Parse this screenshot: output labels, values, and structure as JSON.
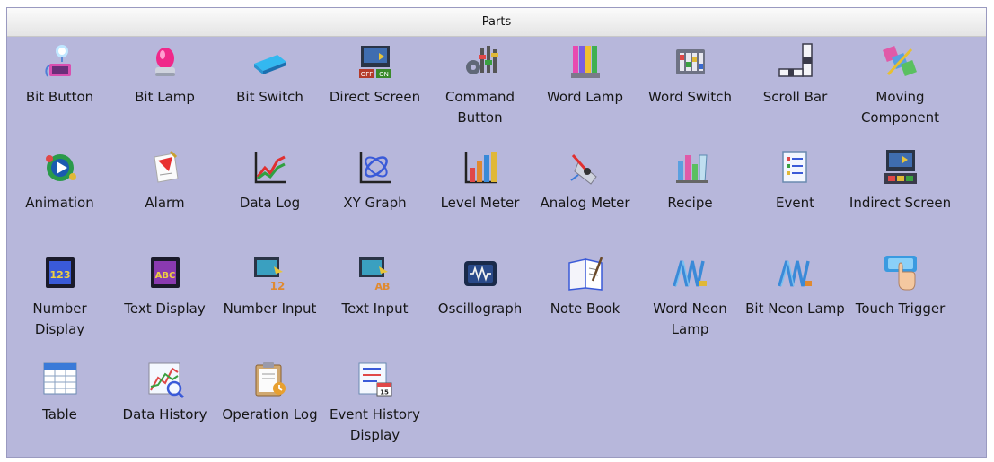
{
  "panel": {
    "title": "Parts"
  },
  "parts": [
    {
      "label": "Bit Button",
      "icon": "bit-button-icon"
    },
    {
      "label": "Bit Lamp",
      "icon": "bit-lamp-icon"
    },
    {
      "label": "Bit Switch",
      "icon": "bit-switch-icon"
    },
    {
      "label": "Direct Screen",
      "icon": "direct-screen-icon"
    },
    {
      "label": "Command Button",
      "icon": "command-button-icon"
    },
    {
      "label": "Word Lamp",
      "icon": "word-lamp-icon"
    },
    {
      "label": "Word Switch",
      "icon": "word-switch-icon"
    },
    {
      "label": "Scroll Bar",
      "icon": "scroll-bar-icon"
    },
    {
      "label": "Moving Component",
      "icon": "moving-component-icon"
    },
    {
      "label": "Animation",
      "icon": "animation-icon"
    },
    {
      "label": "Alarm",
      "icon": "alarm-icon"
    },
    {
      "label": "Data Log",
      "icon": "data-log-icon"
    },
    {
      "label": "XY Graph",
      "icon": "xy-graph-icon"
    },
    {
      "label": "Level Meter",
      "icon": "level-meter-icon"
    },
    {
      "label": "Analog Meter",
      "icon": "analog-meter-icon"
    },
    {
      "label": "Recipe",
      "icon": "recipe-icon"
    },
    {
      "label": "Event",
      "icon": "event-icon"
    },
    {
      "label": "Indirect Screen",
      "icon": "indirect-screen-icon"
    },
    {
      "label": "Number Display",
      "icon": "number-display-icon"
    },
    {
      "label": "Text Display",
      "icon": "text-display-icon"
    },
    {
      "label": "Number Input",
      "icon": "number-input-icon"
    },
    {
      "label": "Text Input",
      "icon": "text-input-icon"
    },
    {
      "label": "Oscillograph",
      "icon": "oscillograph-icon"
    },
    {
      "label": "Note Book",
      "icon": "note-book-icon"
    },
    {
      "label": "Word Neon Lamp",
      "icon": "word-neon-lamp-icon"
    },
    {
      "label": "Bit Neon Lamp",
      "icon": "bit-neon-lamp-icon"
    },
    {
      "label": "Touch Trigger",
      "icon": "touch-trigger-icon"
    },
    {
      "label": "Table",
      "icon": "table-icon"
    },
    {
      "label": "Data History",
      "icon": "data-history-icon"
    },
    {
      "label": "Operation Log",
      "icon": "operation-log-icon"
    },
    {
      "label": "Event History Display",
      "icon": "event-history-display-icon"
    }
  ],
  "icon_text": {
    "direct_screen_off": "OFF",
    "direct_screen_on": "ON",
    "number_display_digits": "123",
    "text_display_letters": "ABC",
    "number_input_digits": "12",
    "text_input_letters": "AB",
    "event_history_day": "15"
  },
  "colors": {
    "panel_background": "#b7b7db",
    "titlebar_top": "#fbfbfb",
    "titlebar_bottom": "#e4e4e4",
    "label_text": "#161616"
  }
}
